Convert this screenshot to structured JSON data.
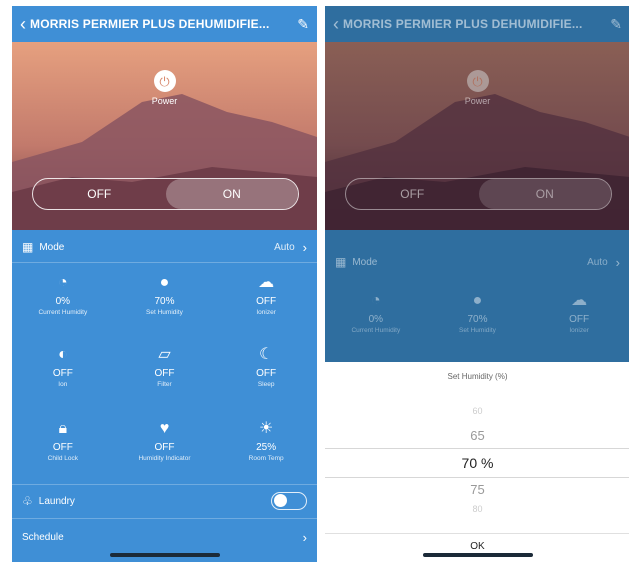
{
  "header": {
    "title": "MORRIS PERMIER PLUS DEHUMIDIFIE..."
  },
  "power": {
    "label": "Power"
  },
  "toggle": {
    "off": "OFF",
    "on": "ON"
  },
  "mode": {
    "label": "Mode",
    "value": "Auto"
  },
  "stats": [
    {
      "icon": "humidity-drop-icon",
      "value": "0%",
      "label": "Current Humidity"
    },
    {
      "icon": "water-drop-icon",
      "value": "70%",
      "label": "Set Humidity"
    },
    {
      "icon": "leaf-icon",
      "value": "OFF",
      "label": "Ionizer"
    },
    {
      "icon": "half-circle-icon",
      "value": "OFF",
      "label": "Ion"
    },
    {
      "icon": "filter-icon",
      "value": "OFF",
      "label": "Filter"
    },
    {
      "icon": "moon-icon",
      "value": "OFF",
      "label": "Sleep"
    },
    {
      "icon": "lock-icon",
      "value": "OFF",
      "label": "Child Lock"
    },
    {
      "icon": "bulb-icon",
      "value": "OFF",
      "label": "Humidity Indicator"
    },
    {
      "icon": "sun-icon",
      "value": "25%",
      "label": "Room Temp"
    }
  ],
  "laundry": {
    "label": "Laundry"
  },
  "schedule": {
    "label": "Schedule"
  },
  "picker": {
    "title": "Set Humidity (%)",
    "options": [
      "60",
      "65",
      "70 %",
      "75",
      "80"
    ],
    "selected_index": 2,
    "ok": "OK"
  },
  "colors": {
    "panel": "#3f8fd6",
    "panel_dim": "#2f6e9f",
    "hero_top": "#e7a27f",
    "hero_bottom": "#6a3a43"
  }
}
